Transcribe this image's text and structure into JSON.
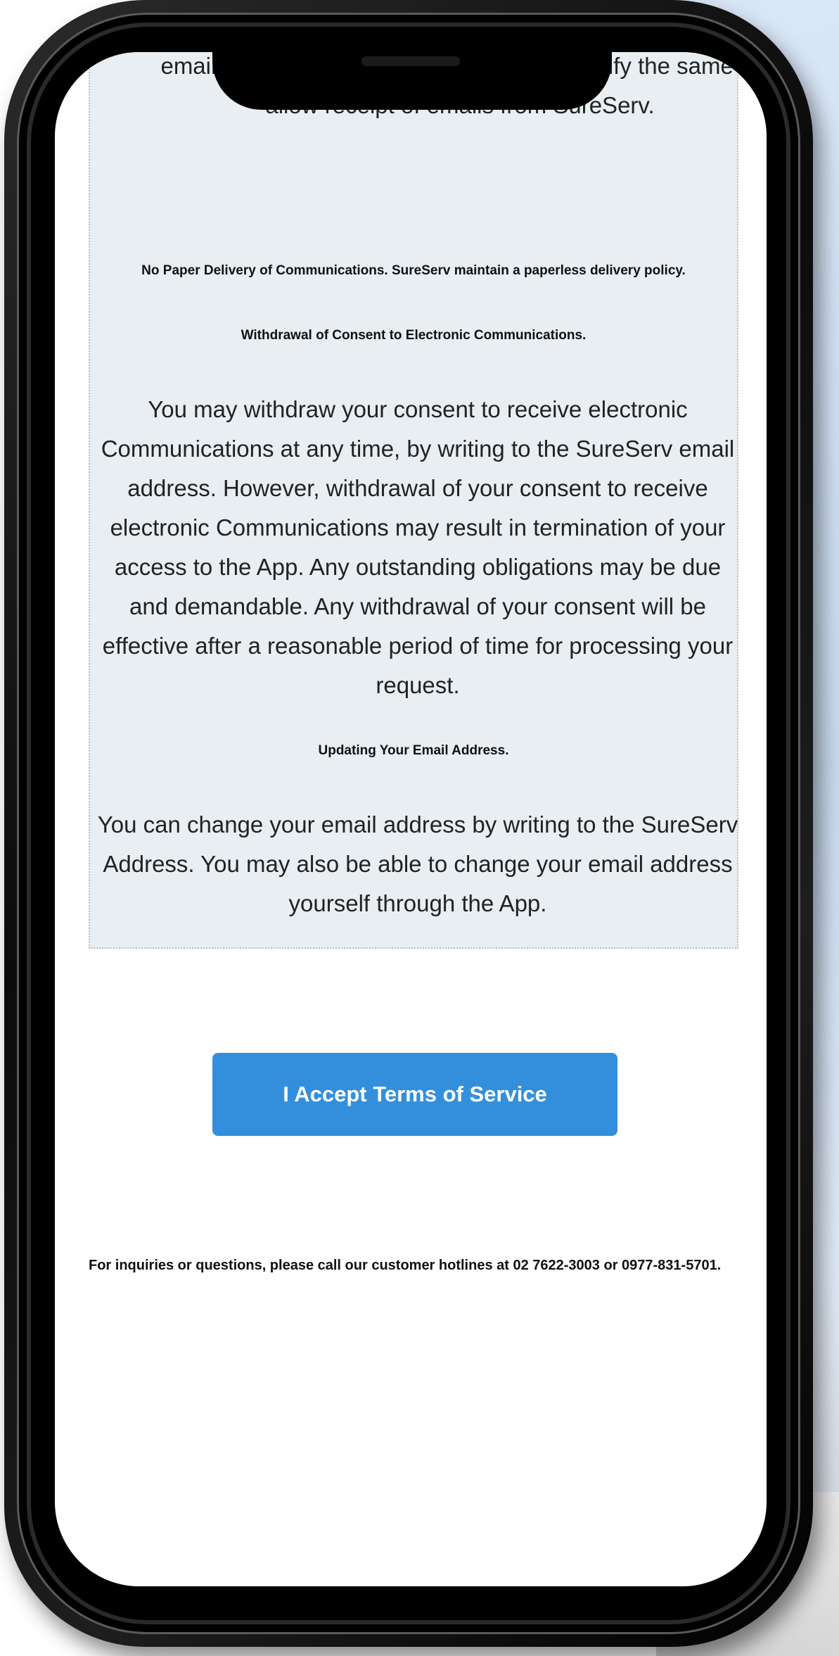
{
  "panel": {
    "intro_text": "email ... email address book, you must modify the same to allow receipt of emails from SureServ.",
    "no_paper_text": "No Paper Delivery of Communications. SureServ maintain a paperless delivery policy.",
    "withdraw_heading": "Withdrawal of Consent to Electronic Communications.",
    "withdraw_text": "You may withdraw your consent to receive electronic Communications at any time, by writing to the SureServ email address. However, withdrawal of your consent to receive electronic Communications may result in termination of your access to the App. Any outstanding obligations may be due and demandable. Any withdrawal of your consent will be effective after a reasonable period of time for processing your request.",
    "update_heading": "Updating Your Email Address.",
    "update_text": "You can change your email address by writing to the SureServ Address. You may also be able to change your email address yourself through the App."
  },
  "accept_button": {
    "label": "I Accept Terms of Service"
  },
  "footer": {
    "text": "For inquiries or questions, please call our customer hotlines at 02 7622-3003 or 0977-831-5701."
  },
  "colors": {
    "accent": "#338fdc",
    "panel_bg": "#e8eef1"
  }
}
